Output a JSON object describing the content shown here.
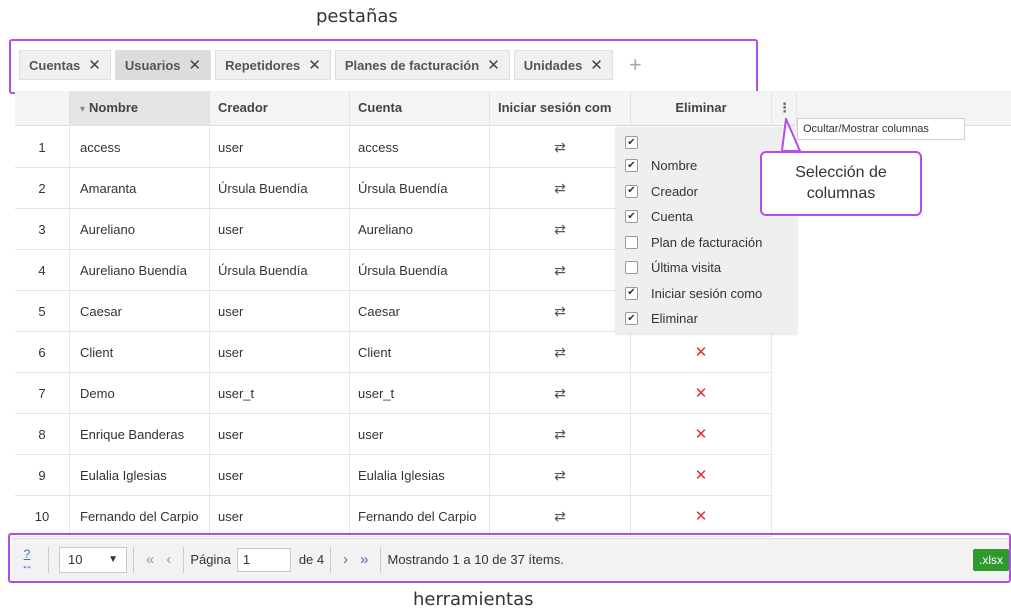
{
  "annotations": {
    "tabs_title": "pestañas",
    "tools_title": "herramientas",
    "column_selection": [
      "Selección de",
      "columnas"
    ]
  },
  "tabs": [
    {
      "label": "Cuentas",
      "active": false
    },
    {
      "label": "Usuarios",
      "active": true
    },
    {
      "label": "Repetidores",
      "active": false
    },
    {
      "label": "Planes de facturación",
      "active": false
    },
    {
      "label": "Unidades",
      "active": false
    }
  ],
  "tab_close_glyph": "✕",
  "tab_add_glyph": "+",
  "grid": {
    "columns": {
      "name": "Nombre",
      "creator": "Creador",
      "account": "Cuenta",
      "login_as": "Iniciar sesión com",
      "delete": "Eliminar"
    },
    "sort_indicator": "▾",
    "column_menu_glyph": "⋮",
    "login_glyph": "⇄",
    "delete_glyph": "✕",
    "rows": [
      {
        "n": "1",
        "name": "access",
        "creator": "user",
        "account": "access"
      },
      {
        "n": "2",
        "name": "Amaranta",
        "creator": "Úrsula Buendía",
        "account": "Úrsula Buendía"
      },
      {
        "n": "3",
        "name": "Aureliano",
        "creator": "user",
        "account": "Aureliano"
      },
      {
        "n": "4",
        "name": "Aureliano Buendía",
        "creator": "Úrsula Buendía",
        "account": "Úrsula Buendía"
      },
      {
        "n": "5",
        "name": "Caesar",
        "creator": "user",
        "account": "Caesar"
      },
      {
        "n": "6",
        "name": "Client",
        "creator": "user",
        "account": "Client"
      },
      {
        "n": "7",
        "name": "Demo",
        "creator": "user_t",
        "account": "user_t"
      },
      {
        "n": "8",
        "name": "Enrique Banderas",
        "creator": "user",
        "account": "user"
      },
      {
        "n": "9",
        "name": "Eulalia Iglesias",
        "creator": "user",
        "account": "Eulalia Iglesias"
      },
      {
        "n": "10",
        "name": "Fernando del Carpio",
        "creator": "user",
        "account": "Fernando del Carpio"
      }
    ]
  },
  "column_picker": {
    "tooltip": "Ocultar/Mostrar columnas",
    "options": [
      {
        "label": "",
        "checked": true
      },
      {
        "label": "Nombre",
        "checked": true
      },
      {
        "label": "Creador",
        "checked": true
      },
      {
        "label": "Cuenta",
        "checked": true
      },
      {
        "label": "Plan de facturación",
        "checked": false
      },
      {
        "label": "Última visita",
        "checked": false
      },
      {
        "label": "Iniciar sesión como",
        "checked": true
      },
      {
        "label": "Eliminar",
        "checked": true
      }
    ]
  },
  "toolbar": {
    "help": "?",
    "page_size": "10",
    "first_glyph": "«",
    "prev_glyph": "‹",
    "page_label": "Página",
    "page_value": "1",
    "of_label": "de 4",
    "next_glyph": "›",
    "last_glyph": "»",
    "status": "Mostrando 1 a 10 de 37 ítems.",
    "export_label": ".xlsx"
  },
  "colors": {
    "annotation_purple": "#b34ee8",
    "delete_red": "#e03030",
    "export_green": "#2e9a2e"
  }
}
